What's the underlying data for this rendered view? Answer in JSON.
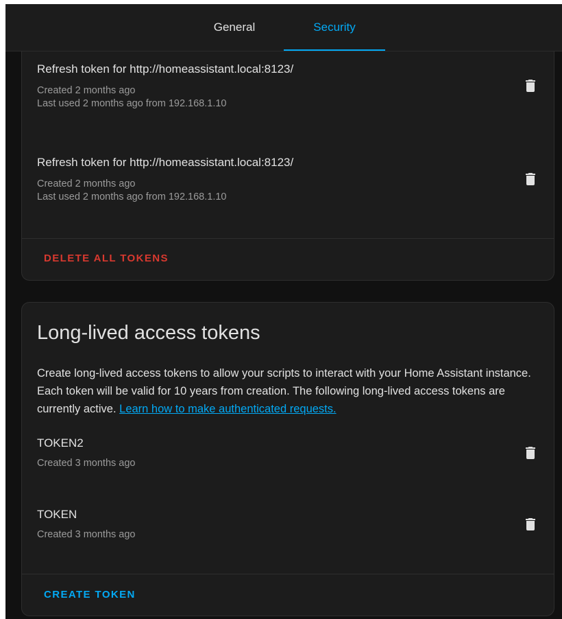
{
  "tabs": {
    "general": "General",
    "security": "Security"
  },
  "refresh_tokens": {
    "items": [
      {
        "title": "Refresh token for http://homeassistant.local:8123/",
        "created": "Created 2 months ago",
        "last_used": "Last used 2 months ago from 192.168.1.10"
      },
      {
        "title": "Refresh token for http://homeassistant.local:8123/",
        "created": "Created 2 months ago",
        "last_used": "Last used 2 months ago from 192.168.1.10"
      }
    ],
    "delete_all_label": "DELETE ALL TOKENS"
  },
  "long_lived": {
    "heading": "Long-lived access tokens",
    "description": "Create long-lived access tokens to allow your scripts to interact with your Home Assistant instance. Each token will be valid for 10 years from creation. The following long-lived access tokens are currently active.",
    "learn_link": "Learn how to make authenticated requests.",
    "items": [
      {
        "name": "TOKEN2",
        "created": "Created 3 months ago"
      },
      {
        "name": "TOKEN",
        "created": "Created 3 months ago"
      }
    ],
    "create_label": "CREATE TOKEN"
  },
  "icons": {
    "delete": "trash-icon"
  },
  "colors": {
    "accent": "#03a9f4",
    "danger": "#d8392f",
    "card": "#1c1c1c",
    "background": "#111111"
  }
}
